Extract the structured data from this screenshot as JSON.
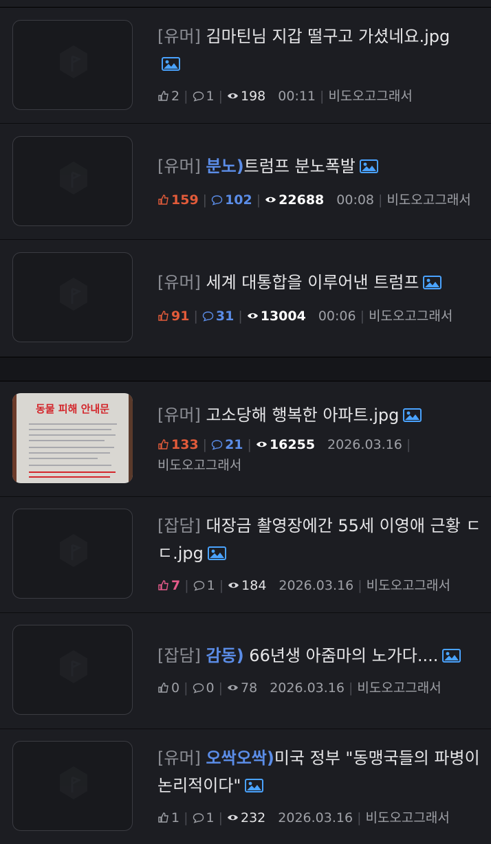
{
  "items": [
    {
      "tag": "[유머]",
      "highlight": "",
      "title": " 김마틴님 지갑 떨구고 가셨네요.jpg",
      "likes": "2",
      "comments": "1",
      "views": "198",
      "time": "00:11",
      "author": "비도오고그래서"
    },
    {
      "tag": "[유머]",
      "highlight": "분노)",
      "title": "트럼프 분노폭발",
      "likes": "159",
      "comments": "102",
      "views": "22688",
      "time": "00:08",
      "author": "비도오고그래서"
    },
    {
      "tag": "[유머]",
      "highlight": "",
      "title": " 세계 대통합을 이루어낸 트럼프",
      "likes": "91",
      "comments": "31",
      "views": "13004",
      "time": "00:06",
      "author": "비도오고그래서"
    },
    {
      "tag": "[유머]",
      "highlight": "",
      "title": " 고소당해 행복한 아파트.jpg",
      "likes": "133",
      "comments": "21",
      "views": "16255",
      "time": "2026.03.16",
      "author": "비도오고그래서",
      "thumb_text": "동물 피해 안내문"
    },
    {
      "tag": "[잡담]",
      "highlight": "",
      "title": " 대장금 촬영장에간 55세 이영애 근황 ㄷㄷ.jpg",
      "likes": "7",
      "comments": "1",
      "views": "184",
      "time": "2026.03.16",
      "author": "비도오고그래서"
    },
    {
      "tag": "[잡담]",
      "highlight": "감동)",
      "title": " 66년생 아줌마의 노가다....",
      "likes": "0",
      "comments": "0",
      "views": "78",
      "time": "2026.03.16",
      "author": "비도오고그래서"
    },
    {
      "tag": "[유머]",
      "highlight": "오싹오싹)",
      "title": "미국 정부 \"동맹국들의 파병이 논리적이다\"",
      "likes": "1",
      "comments": "1",
      "views": "232",
      "time": "2026.03.16",
      "author": "비도오고그래서"
    }
  ],
  "colors": {
    "background": "#1c1d22",
    "hot_likes": "#e25b3a",
    "hot_comments": "#5b8de8",
    "highlight": "#5b8de8",
    "pink_likes": "#e55a8a",
    "image_icon": "#4aa3ff"
  },
  "icons": {
    "like": "thumbs-up-icon",
    "comment": "comment-icon",
    "view": "eye-icon",
    "image": "image-icon"
  }
}
